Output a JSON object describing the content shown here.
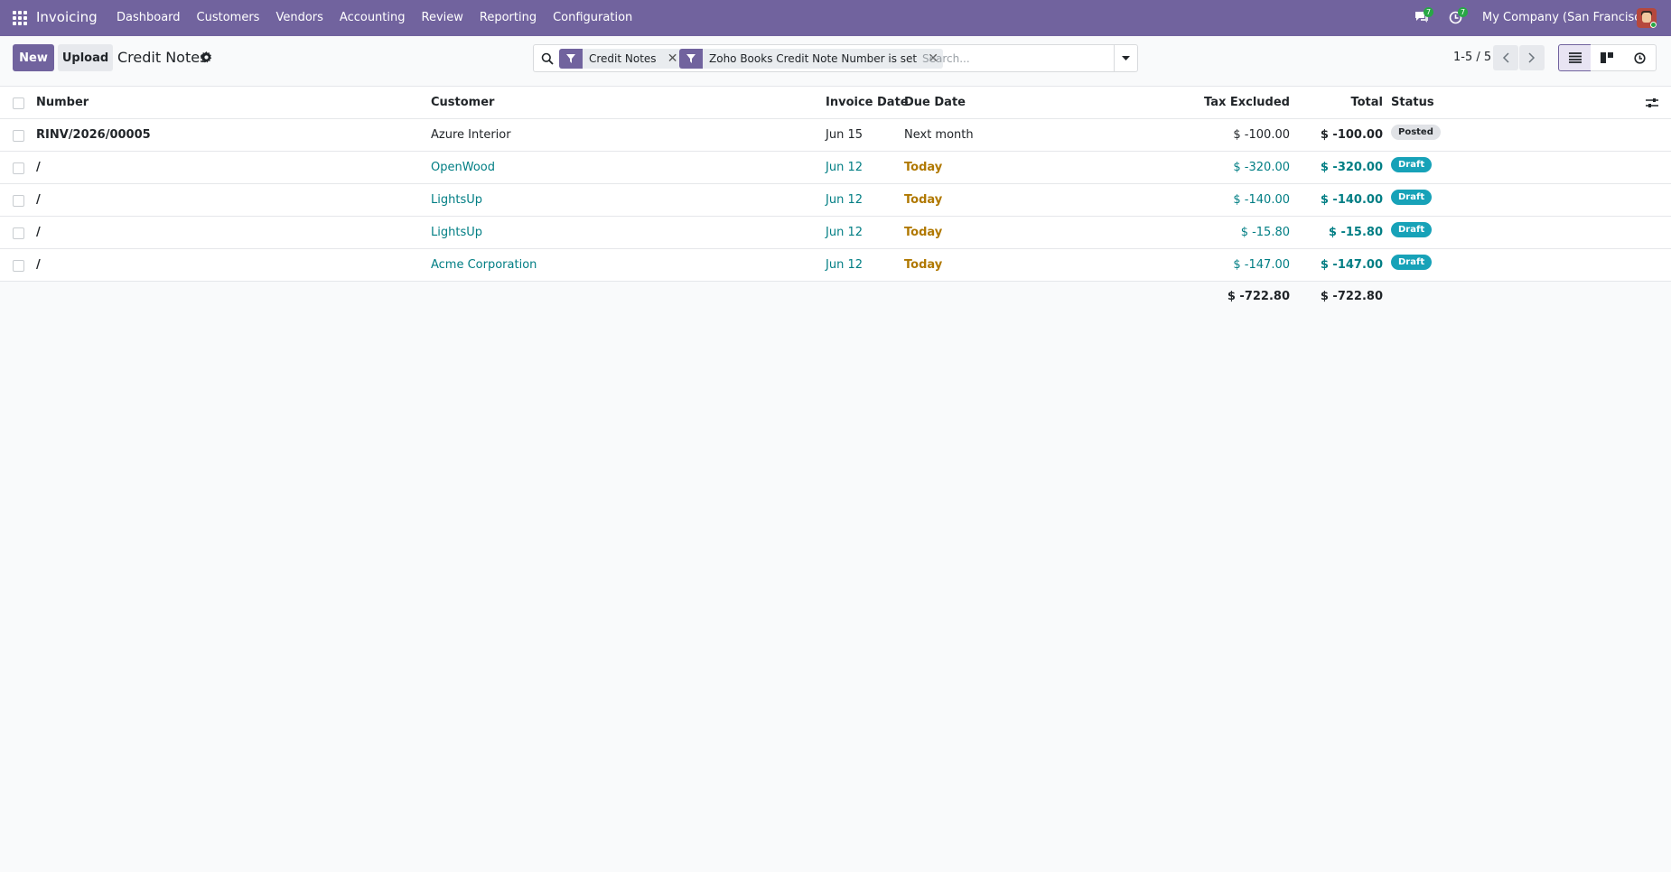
{
  "navbar": {
    "app_name": "Invoicing",
    "menu": [
      "Dashboard",
      "Customers",
      "Vendors",
      "Accounting",
      "Review",
      "Reporting",
      "Configuration"
    ],
    "messages_count": "7",
    "activities_count": "7",
    "company": "My Company (San Francisco)"
  },
  "control_panel": {
    "new_label": "New",
    "upload_label": "Upload",
    "title": "Credit Notes",
    "facets": [
      "Credit Notes",
      "Zoho Books Credit Note Number is set"
    ],
    "search_placeholder": "Search...",
    "pager": "1-5 / 5"
  },
  "table": {
    "columns": [
      "Number",
      "Customer",
      "Invoice Date",
      "Due Date",
      "Tax Excluded",
      "Total",
      "Status"
    ],
    "rows": [
      {
        "number": "RINV/2026/00005",
        "customer": "Azure Interior",
        "invoice_date": "Jun 15",
        "due_date": "Next month",
        "tax_excluded": "$ -100.00",
        "total": "$ -100.00",
        "status": "Posted"
      },
      {
        "number": "/",
        "customer": "OpenWood",
        "invoice_date": "Jun 12",
        "due_date": "Today",
        "tax_excluded": "$ -320.00",
        "total": "$ -320.00",
        "status": "Draft"
      },
      {
        "number": "/",
        "customer": "LightsUp",
        "invoice_date": "Jun 12",
        "due_date": "Today",
        "tax_excluded": "$ -140.00",
        "total": "$ -140.00",
        "status": "Draft"
      },
      {
        "number": "/",
        "customer": "LightsUp",
        "invoice_date": "Jun 12",
        "due_date": "Today",
        "tax_excluded": "$ -15.80",
        "total": "$ -15.80",
        "status": "Draft"
      },
      {
        "number": "/",
        "customer": "Acme Corporation",
        "invoice_date": "Jun 12",
        "due_date": "Today",
        "tax_excluded": "$ -147.00",
        "total": "$ -147.00",
        "status": "Draft"
      }
    ],
    "totals": {
      "tax_excluded": "$ -722.80",
      "total": "$ -722.80"
    }
  },
  "colors": {
    "brand": "#71639e",
    "link": "#017e84",
    "today": "#b07800",
    "draft": "#17a2b8",
    "posted": "#e0e2e6"
  },
  "icons": [
    "apps-grid-icon",
    "chat-icon",
    "activity-clock-icon",
    "gear-icon",
    "search-icon",
    "filter-icon",
    "close-icon",
    "caret-down-icon",
    "chevron-left-icon",
    "chevron-right-icon",
    "list-view-icon",
    "kanban-view-icon",
    "activity-view-icon",
    "optional-columns-icon"
  ]
}
